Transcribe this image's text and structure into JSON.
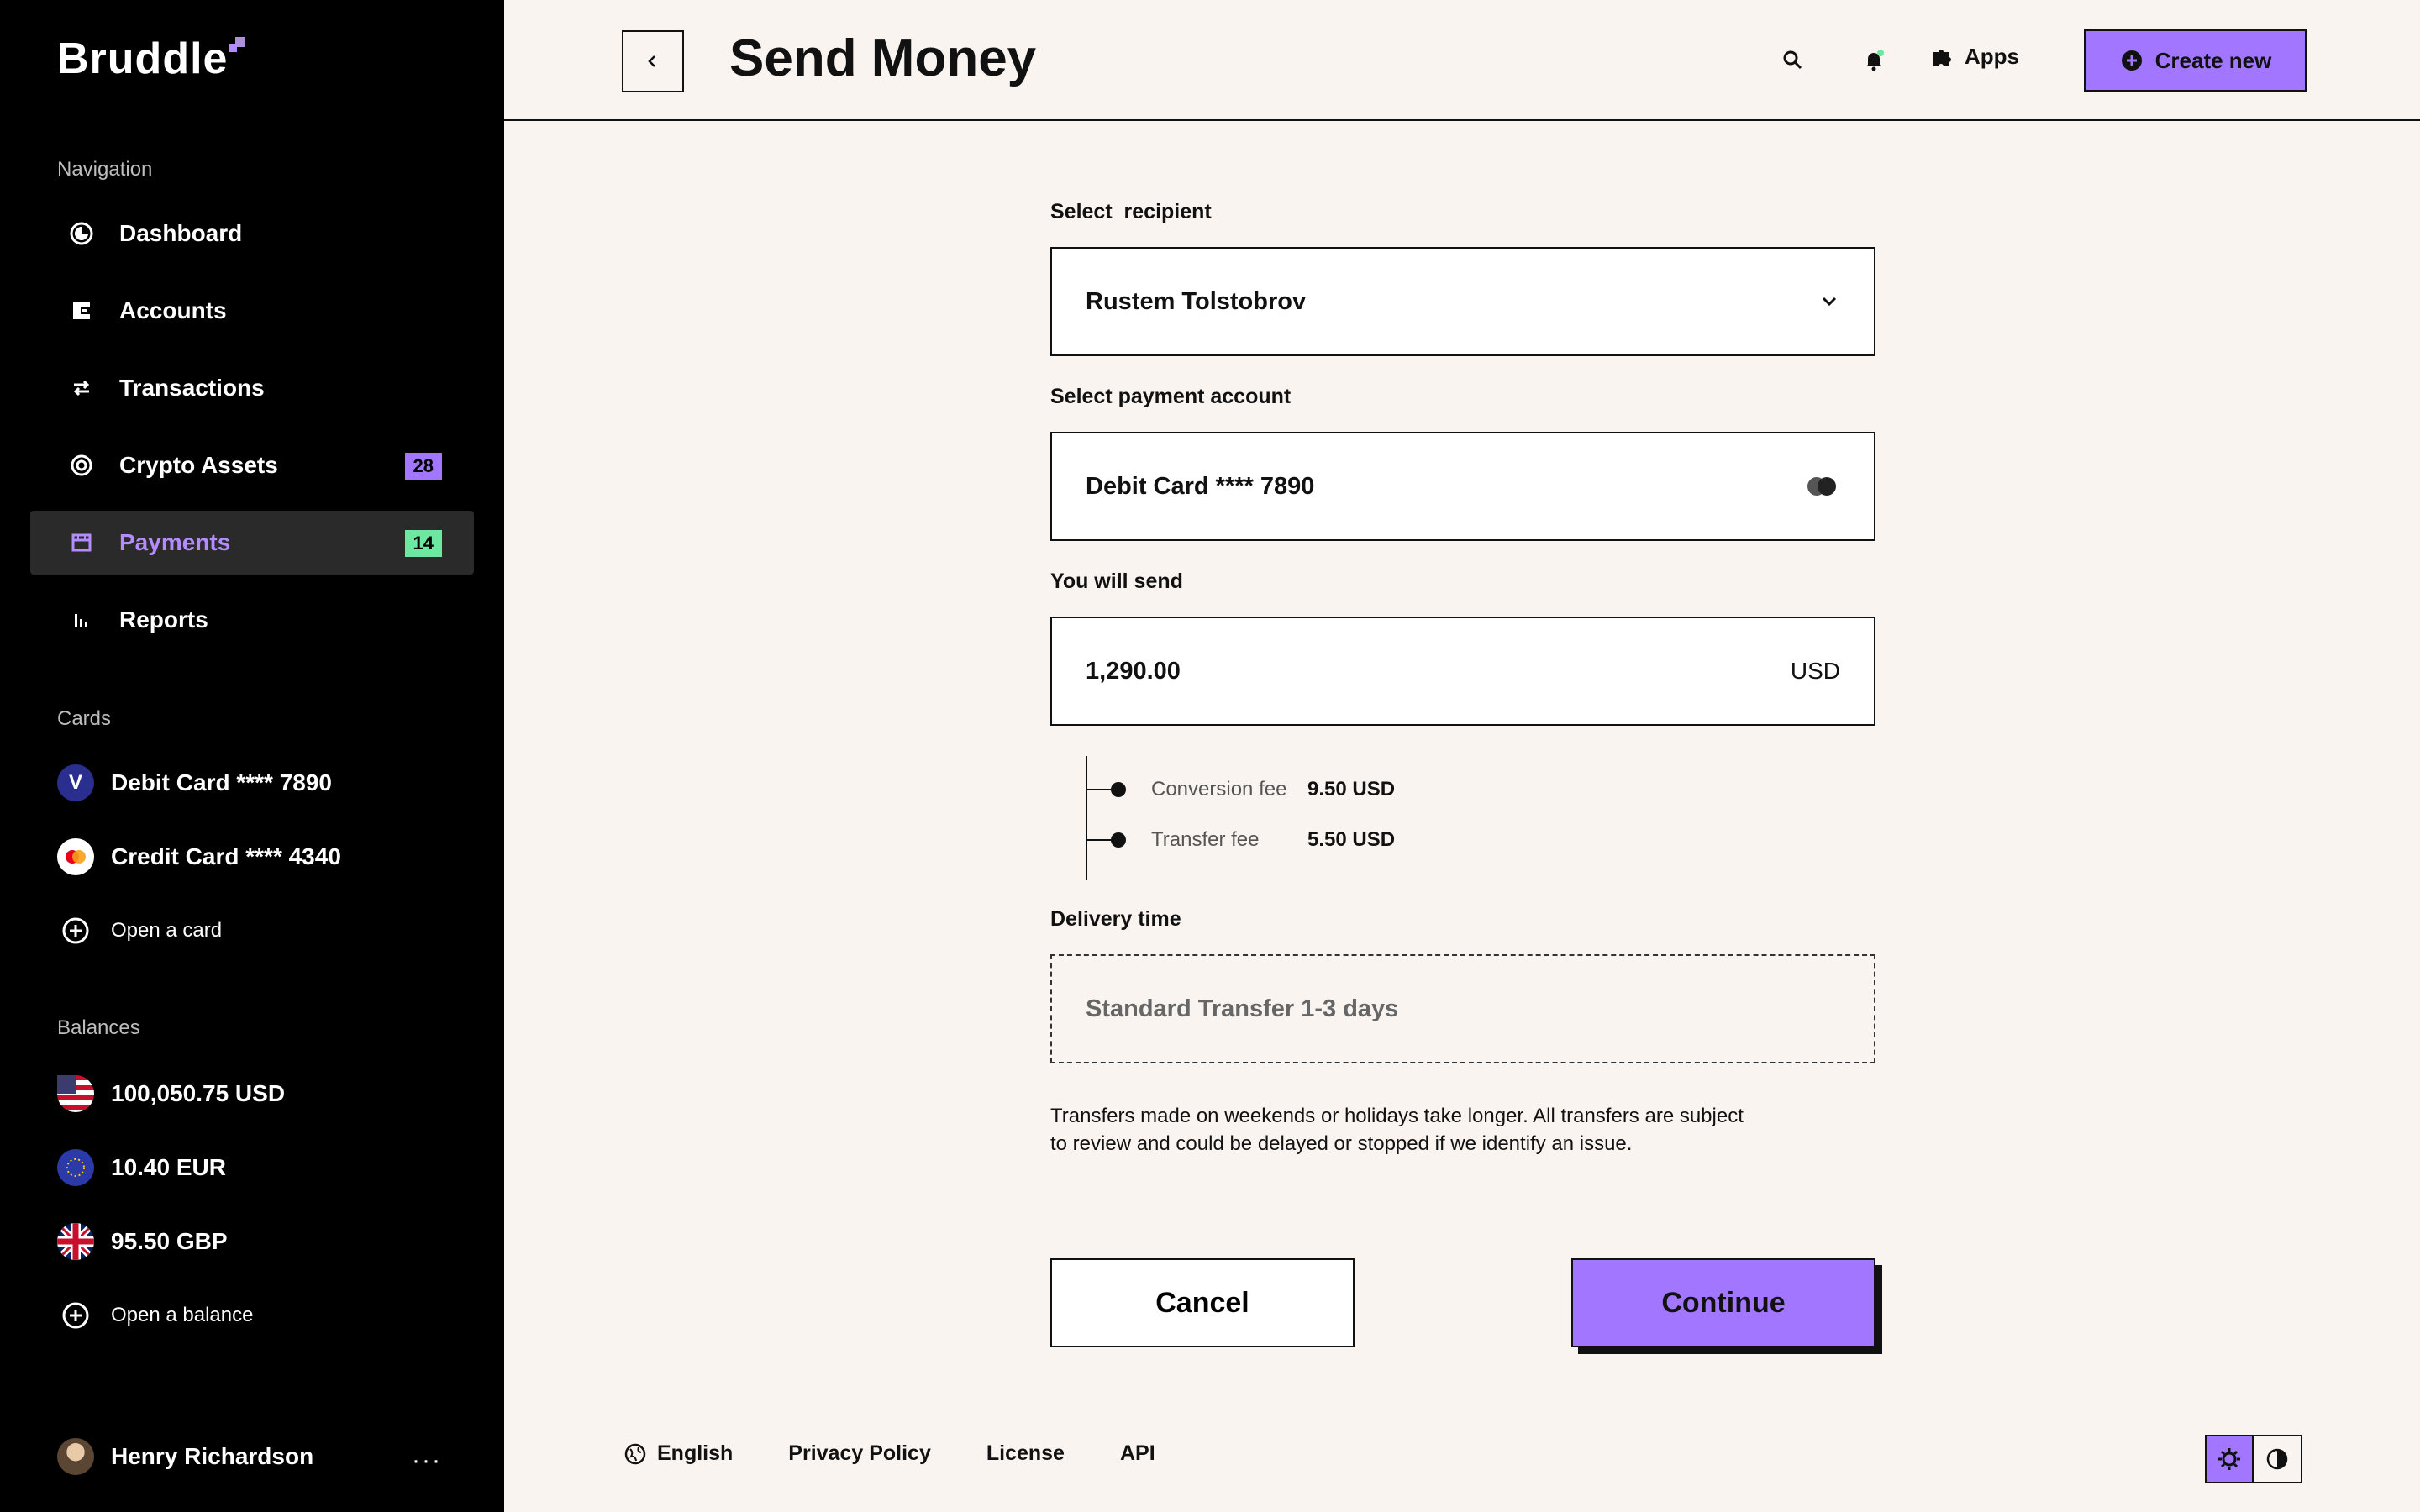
{
  "brand": {
    "name": "Bruddle"
  },
  "sidebar": {
    "nav_heading": "Navigation",
    "nav": [
      {
        "label": "Dashboard",
        "icon": "dashboard-icon"
      },
      {
        "label": "Accounts",
        "icon": "wallet-icon"
      },
      {
        "label": "Transactions",
        "icon": "transfer-arrows-icon"
      },
      {
        "label": "Crypto Assets",
        "icon": "crypto-icon",
        "badge": "28"
      },
      {
        "label": "Payments",
        "icon": "payments-icon",
        "badge": "14",
        "active": true
      },
      {
        "label": "Reports",
        "icon": "bar-chart-icon"
      }
    ],
    "cards_heading": "Cards",
    "cards": [
      {
        "label": "Debit Card **** 7890",
        "icon": "visa-icon"
      },
      {
        "label": "Credit Card **** 4340",
        "icon": "mastercard-icon"
      }
    ],
    "open_card": "Open a card",
    "balances_heading": "Balances",
    "balances": [
      {
        "label": "100,050.75 USD",
        "icon": "us-flag-icon"
      },
      {
        "label": "10.40 EUR",
        "icon": "eu-flag-icon"
      },
      {
        "label": "95.50 GBP",
        "icon": "uk-flag-icon"
      }
    ],
    "open_balance": "Open a balance",
    "user": {
      "name": "Henry Richardson",
      "more": "···"
    }
  },
  "header": {
    "title": "Send Money",
    "apps_label": "Apps",
    "create_label": "Create new"
  },
  "form": {
    "recipient_label": "Select  recipient",
    "recipient_value": "Rustem Tolstobrov",
    "account_label": "Select payment account",
    "account_value": "Debit Card **** 7890",
    "send_label": "You will send",
    "send_amount": "1,290.00",
    "send_currency": "USD",
    "fees": [
      {
        "name": "Conversion fee",
        "value": "9.50 USD"
      },
      {
        "name": "Transfer fee",
        "value": "5.50 USD"
      }
    ],
    "delivery_label": "Delivery time",
    "delivery_value": "Standard Transfer 1-3 days",
    "note_line1": "Transfers made on weekends or holidays take longer. All transfers are subject",
    "note_line2": "to review and could be delayed or stopped if we identify an issue.",
    "cancel_label": "Cancel",
    "continue_label": "Continue"
  },
  "footer": {
    "language": "English",
    "privacy": "Privacy Policy",
    "license": "License",
    "api": "API"
  },
  "colors": {
    "accent": "#a276ff",
    "sidebar_bg": "#000000",
    "page_bg": "#faf4f1",
    "badge_green": "#6ee7a0"
  }
}
